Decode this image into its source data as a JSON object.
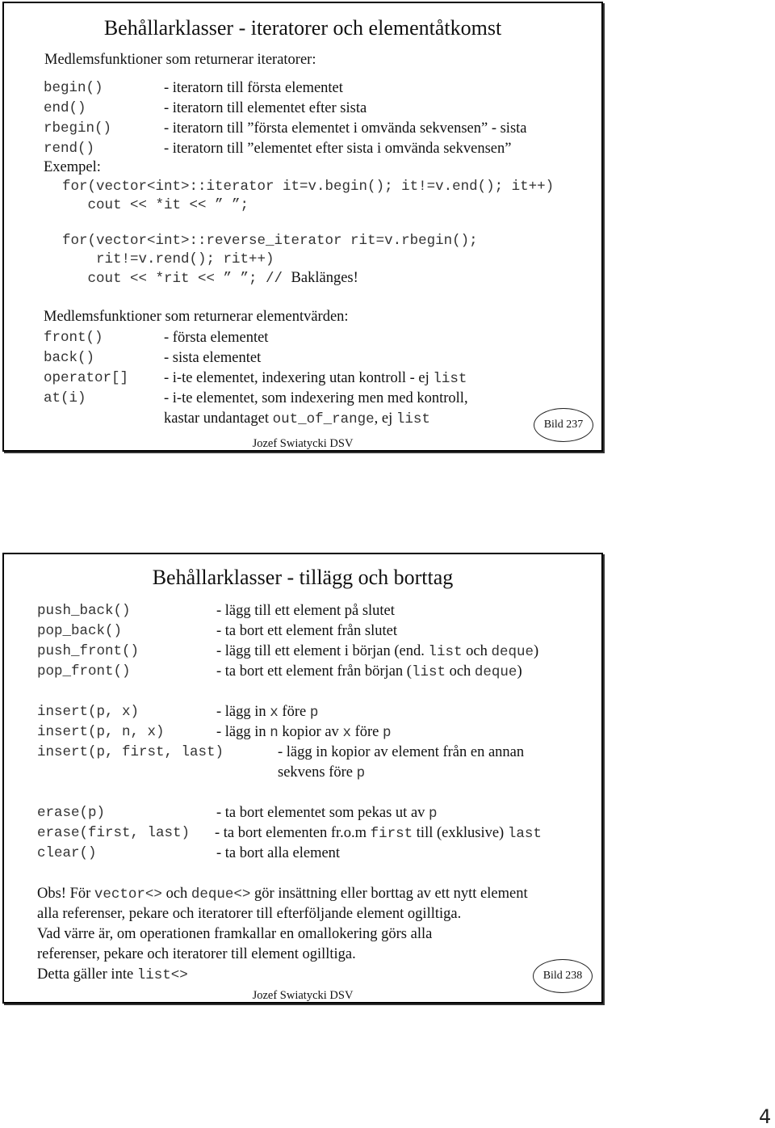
{
  "slide1": {
    "title": "Behållarklasser - iteratorer och elementåtkomst",
    "iter_heading": "Medlemsfunktioner som returnerar iteratorer:",
    "iter_rows": [
      {
        "fn": "begin()",
        "desc": "- iteratorn till första elementet"
      },
      {
        "fn": "end()",
        "desc": "- iteratorn till elementet efter sista"
      },
      {
        "fn": "rbegin()",
        "desc": "- iteratorn till ”första elementet i omvända sekvensen” - sista"
      },
      {
        "fn": "rend()",
        "desc": "- iteratorn till ”elementet efter sista i omvända sekvensen”"
      }
    ],
    "example_label": "Exempel:",
    "code": [
      "for(vector<int>::iterator it=v.begin(); it!=v.end(); it++)",
      "   cout << *it << ” ”;",
      "for(vector<int>::reverse_iterator rit=v.rbegin();",
      "    rit!=v.rend(); rit++)",
      "   cout << *rit << ” ”; // "
    ],
    "code_comment": "Baklänges!",
    "elem_heading": "Medlemsfunktioner som returnerar elementvärden:",
    "elem_rows": [
      {
        "fn": "front()",
        "desc": "- första elementet"
      },
      {
        "fn": "back()",
        "desc": "- sista elementet"
      },
      {
        "fn": "operator[]",
        "desc": "- i-te elementet, indexering utan kontroll - ej ",
        "code": "list"
      },
      {
        "fn": "at(i)",
        "desc": "- i-te elementet, som indexering men med kontroll,"
      }
    ],
    "at_cont": {
      "pre": "kastar undantaget ",
      "code1": "out_of_range",
      "mid": ", ej ",
      "code2": "list"
    },
    "badge": "Bild 237",
    "footer": "Jozef Swiatycki DSV"
  },
  "slide2": {
    "title": "Behållarklasser - tillägg och borttag",
    "push_rows": [
      {
        "fn": "push_back()",
        "desc": "- lägg till ett element på slutet"
      },
      {
        "fn": "pop_back()",
        "desc": "- ta bort ett element från slutet"
      },
      {
        "fn": "push_front()",
        "desc": "- lägg till ett element i början (end. ",
        "c1": "list",
        "t2": " och ",
        "c2": "deque",
        "t3": ")"
      },
      {
        "fn": "pop_front()",
        "desc": "- ta bort ett element från början (",
        "c1": "list",
        "t2": " och ",
        "c2": "deque",
        "t3": ")"
      }
    ],
    "insert_rows": [
      {
        "fn": "insert(p, x)",
        "t1": "- lägg in ",
        "c1": "x",
        "t2": " före ",
        "c2": "p"
      },
      {
        "fn": "insert(p, n, x)",
        "t1": "- lägg in ",
        "c1": "n",
        "t2": " kopior av ",
        "c2": "x",
        "t3": " före ",
        "c3": "p"
      },
      {
        "fn": "insert(p, first, last)",
        "t1": "- lägg in kopior av element från en annan"
      }
    ],
    "insert_cont": {
      "t1": "sekvens före ",
      "c1": "p"
    },
    "erase_rows": [
      {
        "fn": "erase(p)",
        "t1": "- ta bort elementet som pekas ut av ",
        "c1": "p"
      },
      {
        "fn": "erase(first, last)",
        "t1": "- ta bort elementen fr.o.m ",
        "c1": "first",
        "t2": " till (exklusive) ",
        "c2": "last"
      },
      {
        "fn": "clear()",
        "t1": "- ta bort alla element"
      }
    ],
    "note": {
      "l1_a": "Obs! För ",
      "l1_c1": "vector<>",
      "l1_b": " och ",
      "l1_c2": "deque<>",
      "l1_c": " gör insättning eller borttag av ett nytt element",
      "l2": "alla referenser, pekare och iteratorer till efterföljande element ogilltiga.",
      "l3": "Vad värre är, om operationen framkallar en omallokering görs alla",
      "l4": "referenser, pekare och iteratorer till element ogilltiga.",
      "l5_a": "Detta gäller inte ",
      "l5_c": "list<>"
    },
    "badge": "Bild 238",
    "footer": "Jozef Swiatycki DSV"
  },
  "page_number": "4"
}
